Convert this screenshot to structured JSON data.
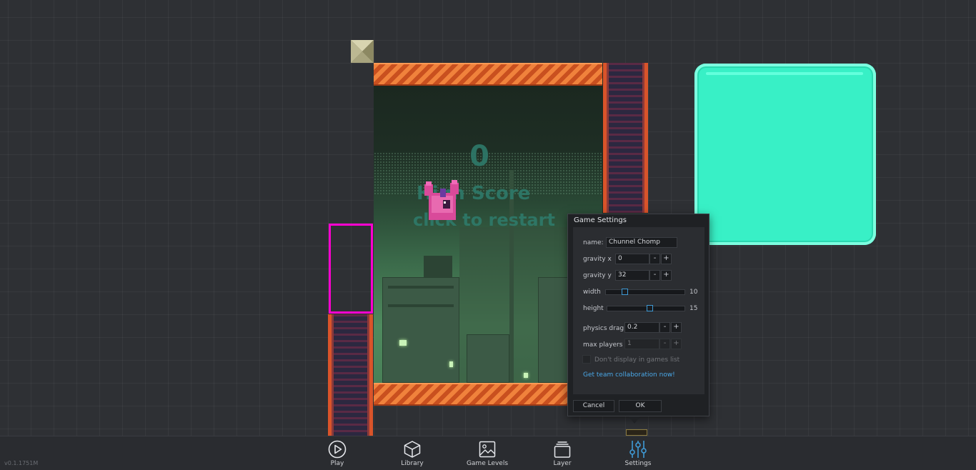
{
  "game": {
    "score": "0",
    "high_score_label": "High Score",
    "restart_label": "click to restart"
  },
  "dialog": {
    "title": "Game Settings",
    "name_label": "name:",
    "name_value": "Chunnel Chomp",
    "gravity_x_label": "gravity x",
    "gravity_x_value": "0",
    "gravity_y_label": "gravity y",
    "gravity_y_value": "32",
    "width_label": "width",
    "width_value": "10",
    "height_label": "height",
    "height_value": "15",
    "physics_drag_label": "physics drag",
    "physics_drag_value": "0.2",
    "max_players_label": "max players",
    "max_players_value": "1",
    "dont_display_label": "Don't display in games list",
    "team_link": "Get team collaboration now!",
    "cancel_label": "Cancel",
    "ok_label": "OK",
    "minus": "-",
    "plus": "+",
    "width_fraction": 0.22,
    "height_fraction": 0.55
  },
  "toolbar": {
    "items": [
      {
        "label": "Play",
        "icon": "play-icon"
      },
      {
        "label": "Library",
        "icon": "cube-icon"
      },
      {
        "label": "Game Levels",
        "icon": "image-icon"
      },
      {
        "label": "Layer",
        "icon": "layers-icon"
      },
      {
        "label": "Settings",
        "icon": "sliders-icon",
        "active": true
      }
    ]
  },
  "version": "v0.1.1751M",
  "colors": {
    "accent": "#3f9ad6",
    "selection": "#ff00d0",
    "teal_panel": "#38f0c6"
  }
}
